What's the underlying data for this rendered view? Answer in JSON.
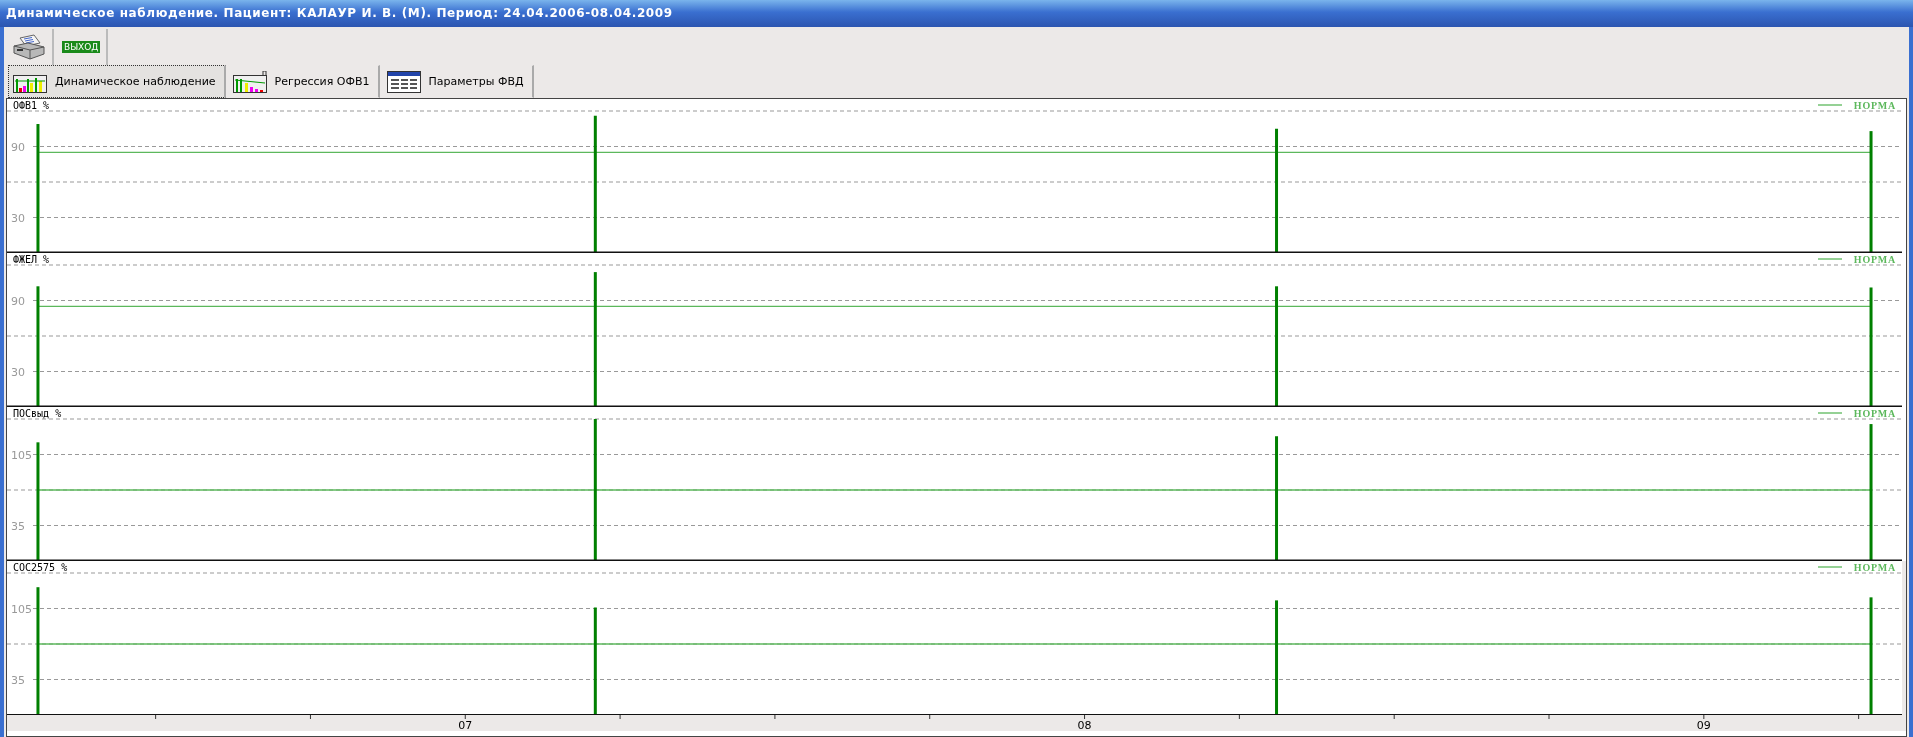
{
  "window": {
    "title": "Динамическое наблюдение. Пациент: КАЛАУР И. В. (М). Период: 24.04.2006-08.04.2009"
  },
  "toolbar": [
    {
      "kind": "print"
    },
    {
      "kind": "exit",
      "label": "ВЫХОД"
    }
  ],
  "tabs": [
    {
      "label": "Динамическое наблюдение",
      "selected": true,
      "kind": "bars"
    },
    {
      "label": "Регрессия ОФВ1",
      "selected": false,
      "kind": "regression"
    },
    {
      "label": "Параметры ФВД",
      "selected": false,
      "kind": "table"
    }
  ],
  "panels": [
    {
      "chart_data": {
        "type": "bar",
        "title": "ОФВ1 %",
        "x": [
          2006.31,
          2007.21,
          2008.31,
          2009.27
        ],
        "xlim": [
          2006.26,
          2009.32
        ],
        "ylim": [
          0,
          120
        ],
        "yticks": [
          30,
          90
        ],
        "series": [
          {
            "color": "#008000",
            "values": [
              109,
              116,
              105,
              103
            ]
          },
          {
            "type": "line",
            "name": "НОРМА",
            "color": "#5cb85c",
            "values": [
              85,
              85,
              85,
              85
            ]
          }
        ]
      }
    },
    {
      "chart_data": {
        "type": "bar",
        "title": "ФЖЕЛ %",
        "x": [
          2006.31,
          2007.21,
          2008.31,
          2009.27
        ],
        "xlim": [
          2006.26,
          2009.32
        ],
        "ylim": [
          0,
          120
        ],
        "yticks": [
          30,
          90
        ],
        "series": [
          {
            "color": "#008000",
            "values": [
              102,
              114,
              102,
              101
            ]
          },
          {
            "type": "line",
            "name": "НОРМА",
            "color": "#5cb85c",
            "values": [
              85,
              85,
              85,
              85
            ]
          }
        ]
      }
    },
    {
      "chart_data": {
        "type": "bar",
        "title": "ПОСвыд %",
        "x": [
          2006.31,
          2007.21,
          2008.31,
          2009.27
        ],
        "xlim": [
          2006.26,
          2009.32
        ],
        "ylim": [
          0,
          140
        ],
        "yticks": [
          35,
          105
        ],
        "series": [
          {
            "color": "#008000",
            "values": [
              117,
              140,
              123,
              135
            ]
          },
          {
            "type": "line",
            "name": "НОРМА",
            "color": "#5cb85c",
            "values": [
              70,
              70,
              70,
              70
            ]
          }
        ]
      }
    },
    {
      "chart_data": {
        "type": "bar",
        "title": "СОС2575 %",
        "x": [
          2006.31,
          2007.21,
          2008.31,
          2009.27
        ],
        "xlim": [
          2006.26,
          2009.32
        ],
        "ylim": [
          0,
          140
        ],
        "yticks": [
          35,
          105
        ],
        "xticks": [
          {
            "value": 2007,
            "label": "07"
          },
          {
            "value": 2008,
            "label": "08"
          },
          {
            "value": 2009,
            "label": "09"
          }
        ],
        "series": [
          {
            "color": "#008000",
            "values": [
              126,
              106,
              113,
              116
            ]
          },
          {
            "type": "line",
            "name": "НОРМА",
            "color": "#5cb85c",
            "values": [
              70,
              70,
              70,
              70
            ]
          }
        ]
      }
    }
  ]
}
